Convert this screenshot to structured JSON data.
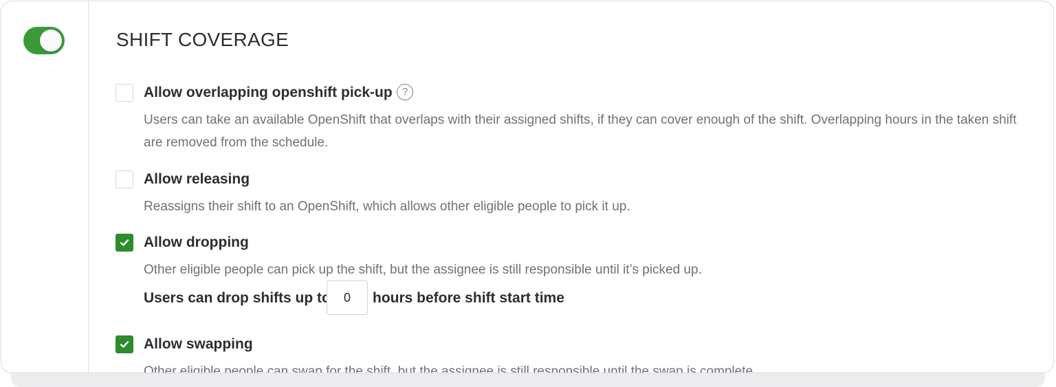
{
  "toggle": {
    "state": "on",
    "color": "#3a9a3a"
  },
  "section": {
    "title": "SHIFT COVERAGE"
  },
  "options": [
    {
      "label": "Allow overlapping openshift pick-up",
      "checked": false,
      "has_help": true,
      "help_glyph": "?",
      "description": "Users can take an available OpenShift that overlaps with their assigned shifts, if they can cover enough of the shift. Overlapping hours in the taken shift are removed from the schedule."
    },
    {
      "label": "Allow releasing",
      "checked": false,
      "description": "Reassigns their shift to an OpenShift, which allows other eligible people to pick it up."
    },
    {
      "label": "Allow dropping",
      "checked": true,
      "description": "Other eligible people can pick up the shift, but the assignee is still responsible until it’s picked up."
    },
    {
      "label": "Allow swapping",
      "checked": true,
      "description": "Other eligible people can swap for the shift, but the assignee is still responsible until the swap is complete."
    }
  ],
  "drop_hours": {
    "prefix": "Users can drop shifts up to",
    "value": "0",
    "suffix": "hours before shift start time"
  },
  "colors": {
    "accent": "#2e8b2e",
    "text": "#2b2d33",
    "muted": "#6e7179"
  }
}
